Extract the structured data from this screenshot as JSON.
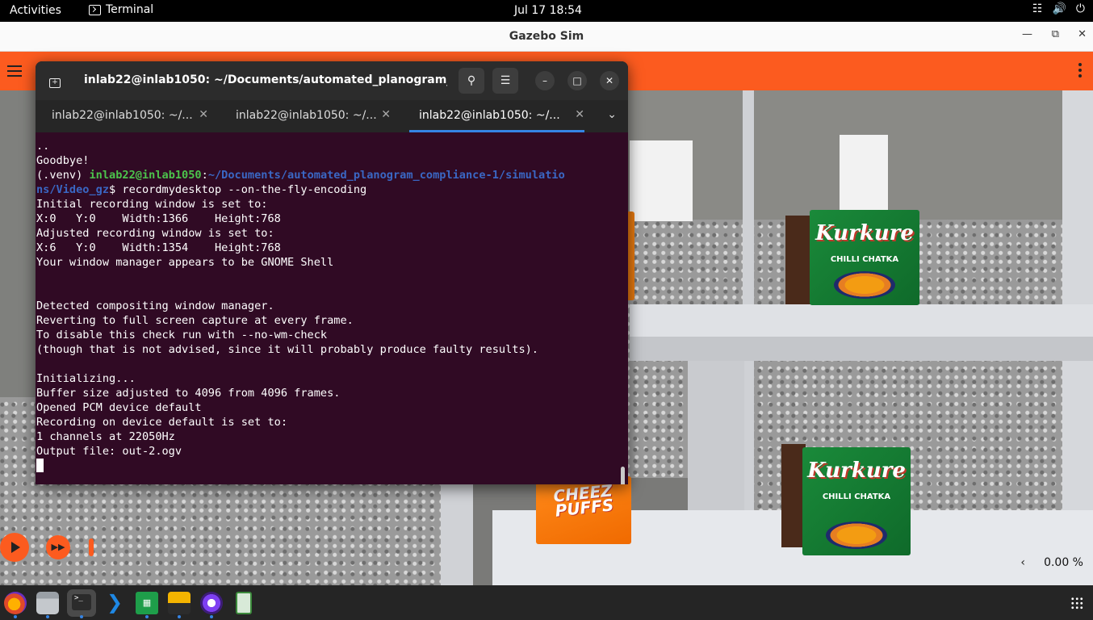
{
  "topbar": {
    "activities": "Activities",
    "app_name": "Terminal",
    "clock": "Jul 17  18:54",
    "tray_icons": [
      "network-icon",
      "volume-icon",
      "power-icon"
    ]
  },
  "gazebo": {
    "window_title": "Gazebo Sim",
    "accent": "#fc5b1f",
    "rtf": "0.00 %",
    "products": {
      "kurkure_brand": "Kurkure",
      "kurkure_flavor": "CHILLI CHATKA",
      "cheez_brand": "CHEEZ PUFFS"
    }
  },
  "terminal": {
    "title": "inlab22@inlab1050: ~/Documents/automated_planogram_co...",
    "tabs": [
      {
        "label": "inlab22@inlab1050: ~/...",
        "active": false
      },
      {
        "label": "inlab22@inlab1050: ~/...",
        "active": false
      },
      {
        "label": "inlab22@inlab1050: ~/...",
        "active": true
      }
    ],
    "prompt": {
      "env": "(.venv) ",
      "user": "inlab22@inlab1050",
      "sep": ":",
      "path_line1": "~/Documents/automated_planogram_compliance-1/simulatio",
      "path_line2": "ns/Video_gz",
      "dollar": "$ ",
      "command": "recordmydesktop --on-the-fly-encoding"
    },
    "lines_before": [
      "..",
      "Goodbye!"
    ],
    "lines_after": [
      "Initial recording window is set to:",
      "X:0   Y:0    Width:1366    Height:768",
      "Adjusted recording window is set to:",
      "X:6   Y:0    Width:1354    Height:768",
      "Your window manager appears to be GNOME Shell",
      "",
      "",
      "Detected compositing window manager.",
      "Reverting to full screen capture at every frame.",
      "To disable this check run with --no-wm-check",
      "(though that is not advised, since it will probably produce faulty results).",
      "",
      "Initializing...",
      "Buffer size adjusted to 4096 from 4096 frames.",
      "Opened PCM device default",
      "Recording on device default is set to:",
      "1 channels at 22050Hz",
      "Output file: out-2.ogv"
    ]
  },
  "dock": {
    "apps": [
      "firefox-icon",
      "files-icon",
      "terminal-icon",
      "vscode-icon",
      "spreadsheet-icon",
      "package-icon",
      "tor-browser-icon",
      "trash-icon"
    ]
  }
}
